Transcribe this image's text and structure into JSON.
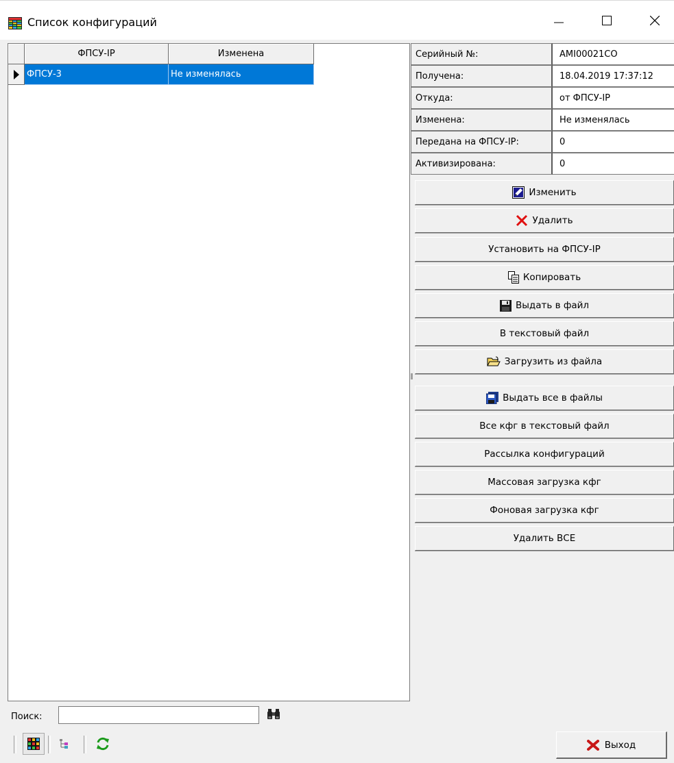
{
  "window": {
    "title": "Список конфигураций",
    "app_icon": "table-icon",
    "controls": {
      "minimize": "minimize-icon",
      "maximize": "maximize-icon",
      "close": "close-icon"
    }
  },
  "grid": {
    "columns": [
      "ФПСУ-IP",
      "Изменена"
    ],
    "rows": [
      {
        "name": "ФПСУ-3",
        "changed": "Не изменялась",
        "selected": true
      }
    ],
    "selection_color": "#0078d7"
  },
  "properties": [
    {
      "label": "Серийный №:",
      "value": "AMI00021CO"
    },
    {
      "label": "Получена:",
      "value": "18.04.2019 17:37:12"
    },
    {
      "label": "Откуда:",
      "value": "от ФПСУ-IP"
    },
    {
      "label": "Изменена:",
      "value": "Не изменялась"
    },
    {
      "label": "Передана на ФПСУ-IP:",
      "value": "0"
    },
    {
      "label": "Активизирована:",
      "value": "0"
    }
  ],
  "actions": {
    "edit": {
      "label": "Изменить",
      "icon": "edit-icon"
    },
    "delete": {
      "label": "Удалить",
      "icon": "delete-x-icon"
    },
    "install": {
      "label": "Установить на ФПСУ-IP"
    },
    "copy": {
      "label": "Копировать",
      "icon": "copy-icon"
    },
    "export_file": {
      "label": "Выдать в файл",
      "icon": "floppy-icon"
    },
    "text_file": {
      "label": "В текстовый файл"
    },
    "load_file": {
      "label": "Загрузить из файла",
      "icon": "open-folder-icon"
    },
    "export_all": {
      "label": "Выдать все в файлы",
      "icon": "floppy-stack-icon"
    },
    "all_text": {
      "label": "Все кфг в текстовый файл"
    },
    "distribute": {
      "label": "Рассылка конфигураций"
    },
    "mass_load": {
      "label": "Массовая загрузка кфг"
    },
    "bg_load": {
      "label": "Фоновая загрузка кфг"
    },
    "delete_all": {
      "label": "Удалить ВСЕ"
    }
  },
  "search": {
    "label": "Поиск:",
    "value": "",
    "icon": "binoculars-icon"
  },
  "toolbar": {
    "grid_view": "grid-view-icon",
    "tree_view": "tree-view-icon",
    "refresh": "refresh-icon"
  },
  "exit": {
    "label": "Выход",
    "icon": "exit-x-icon"
  }
}
